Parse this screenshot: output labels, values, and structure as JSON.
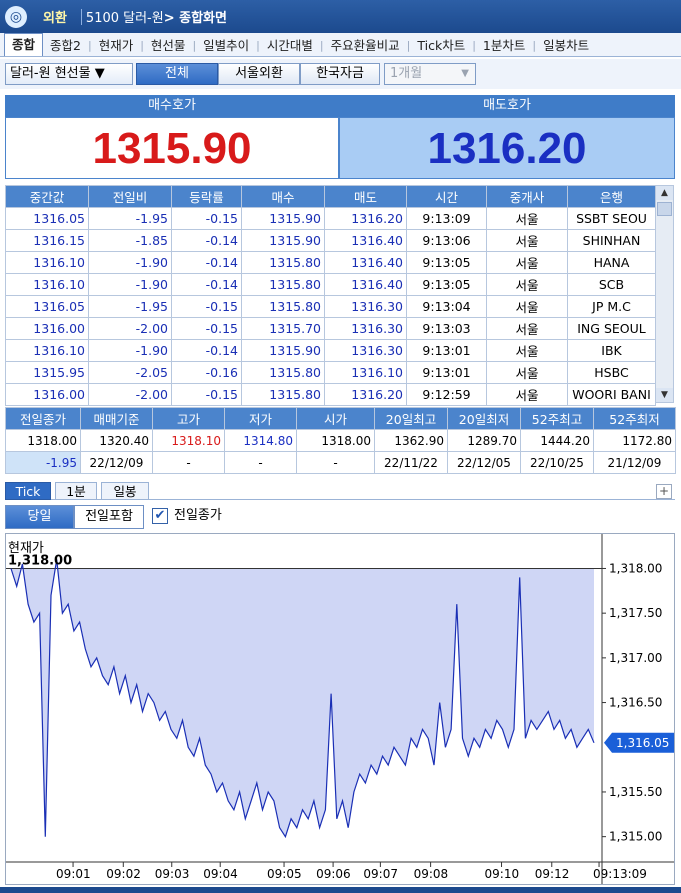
{
  "titlebar": {
    "logo_glyph": "◎",
    "menu_name": "외환",
    "screen_code": "5100 달러-원",
    "screen_name": "> 종합화면"
  },
  "tabs": {
    "active": "종합",
    "items": [
      "종합2",
      "현재가",
      "현선물",
      "일별추이",
      "시간대별",
      "주요환율비교",
      "Tick차트",
      "1분차트",
      "일봉차트"
    ]
  },
  "toolbar": {
    "product_select": "달러-원 현선물 ▼",
    "buttons": [
      "전체",
      "서울외환",
      "한국자금"
    ],
    "period_select": "1개월",
    "period_arrow": "▼"
  },
  "quotes": {
    "bid_label": "매수호가",
    "bid_value": "1315.90",
    "ask_label": "매도호가",
    "ask_value": "1316.20",
    "bid_color": "#d81a1a",
    "ask_color": "#1a2fc2"
  },
  "trades": {
    "headers": [
      "중간값",
      "전일비",
      "등락률",
      "매수",
      "매도",
      "시간",
      "중개사",
      "은행"
    ],
    "rows": [
      [
        "1316.05",
        "-1.95",
        "-0.15",
        "1315.90",
        "1316.20",
        "9:13:09",
        "서울",
        "SSBT SEOU"
      ],
      [
        "1316.15",
        "-1.85",
        "-0.14",
        "1315.90",
        "1316.40",
        "9:13:06",
        "서울",
        "SHINHAN"
      ],
      [
        "1316.10",
        "-1.90",
        "-0.14",
        "1315.80",
        "1316.40",
        "9:13:05",
        "서울",
        "HANA"
      ],
      [
        "1316.10",
        "-1.90",
        "-0.14",
        "1315.80",
        "1316.40",
        "9:13:05",
        "서울",
        "SCB"
      ],
      [
        "1316.05",
        "-1.95",
        "-0.15",
        "1315.80",
        "1316.30",
        "9:13:04",
        "서울",
        "JP M.C"
      ],
      [
        "1316.00",
        "-2.00",
        "-0.15",
        "1315.70",
        "1316.30",
        "9:13:03",
        "서울",
        "ING SEOUL"
      ],
      [
        "1316.10",
        "-1.90",
        "-0.14",
        "1315.90",
        "1316.30",
        "9:13:01",
        "서울",
        "IBK"
      ],
      [
        "1315.95",
        "-2.05",
        "-0.16",
        "1315.80",
        "1316.10",
        "9:13:01",
        "서울",
        "HSBC"
      ],
      [
        "1316.00",
        "-2.00",
        "-0.15",
        "1315.80",
        "1316.20",
        "9:12:59",
        "서울",
        "WOORI BANI"
      ]
    ]
  },
  "summary": {
    "headers": [
      "전일종가",
      "매매기준",
      "고가",
      "저가",
      "시가",
      "20일최고",
      "20일최저",
      "52주최고",
      "52주최저"
    ],
    "row1": [
      "1318.00",
      "1320.40",
      "1318.10",
      "1314.80",
      "1318.00",
      "1362.90",
      "1289.70",
      "1444.20",
      "1172.80"
    ],
    "row2": [
      "-1.95",
      "22/12/09",
      "-",
      "-",
      "-",
      "22/11/22",
      "22/12/05",
      "22/10/25",
      "21/12/09"
    ],
    "high_color": "#d81a1a",
    "low_color": "#1a2fc2"
  },
  "chart_tabs": [
    "Tick",
    "1분",
    "일봉"
  ],
  "chart_plus": "+",
  "chart_controls": {
    "today": "당일",
    "include_prev": "전일포함",
    "checkbox_label": "전일종가",
    "checkbox_checked": true,
    "check_glyph": "✔"
  },
  "chart_data": {
    "type": "area",
    "title": "현재가",
    "prev_close_label": "1,318.00",
    "current_value_label": "1,316.05",
    "y_ticks": [
      "1,318.00",
      "1,317.50",
      "1,317.00",
      "1,316.50",
      "1,316.05",
      "1,315.50",
      "1,315.00"
    ],
    "x_ticks": [
      "09:01",
      "09:02",
      "09:03",
      "09:04",
      "09:05",
      "09:06",
      "09:07",
      "09:08",
      "09:10",
      "09:12",
      "09:13:09"
    ],
    "ylim": [
      1314.75,
      1318.05
    ],
    "reference_line": 1318.0,
    "last_value": 1316.05,
    "series": [
      {
        "values": [
          1318.0,
          1317.8,
          1318.05,
          1317.6,
          1317.4,
          1317.5,
          1315.0,
          1317.7,
          1318.1,
          1317.5,
          1317.6,
          1317.3,
          1317.4,
          1317.1,
          1316.9,
          1317.0,
          1316.8,
          1316.7,
          1316.9,
          1316.6,
          1316.8,
          1316.5,
          1316.7,
          1316.4,
          1316.6,
          1316.5,
          1316.3,
          1316.4,
          1316.2,
          1316.1,
          1316.3,
          1316.0,
          1315.9,
          1316.1,
          1315.8,
          1315.7,
          1315.5,
          1315.6,
          1315.4,
          1315.3,
          1315.5,
          1315.2,
          1315.4,
          1315.6,
          1315.3,
          1315.5,
          1315.4,
          1315.1,
          1315.0,
          1315.2,
          1315.1,
          1315.3,
          1315.2,
          1315.4,
          1315.1,
          1315.3,
          1316.6,
          1315.2,
          1315.4,
          1315.1,
          1315.5,
          1315.7,
          1315.6,
          1315.8,
          1315.7,
          1315.9,
          1315.8,
          1316.0,
          1315.9,
          1315.8,
          1316.1,
          1316.0,
          1316.2,
          1316.1,
          1315.8,
          1316.5,
          1316.0,
          1316.2,
          1317.6,
          1316.1,
          1315.9,
          1316.1,
          1316.0,
          1316.2,
          1316.1,
          1316.3,
          1316.2,
          1316.0,
          1316.2,
          1317.9,
          1316.1,
          1316.3,
          1316.2,
          1316.3,
          1316.4,
          1316.2,
          1316.3,
          1316.1,
          1316.2,
          1316.0,
          1316.1,
          1316.2,
          1316.05
        ]
      }
    ],
    "fill_color": "#cfd6f5",
    "line_color": "#1a2fb5"
  },
  "colors": {
    "accent": "#2f6bc4",
    "header_blue": "#4b84cc",
    "ask_bg": "#a9ccf4"
  }
}
